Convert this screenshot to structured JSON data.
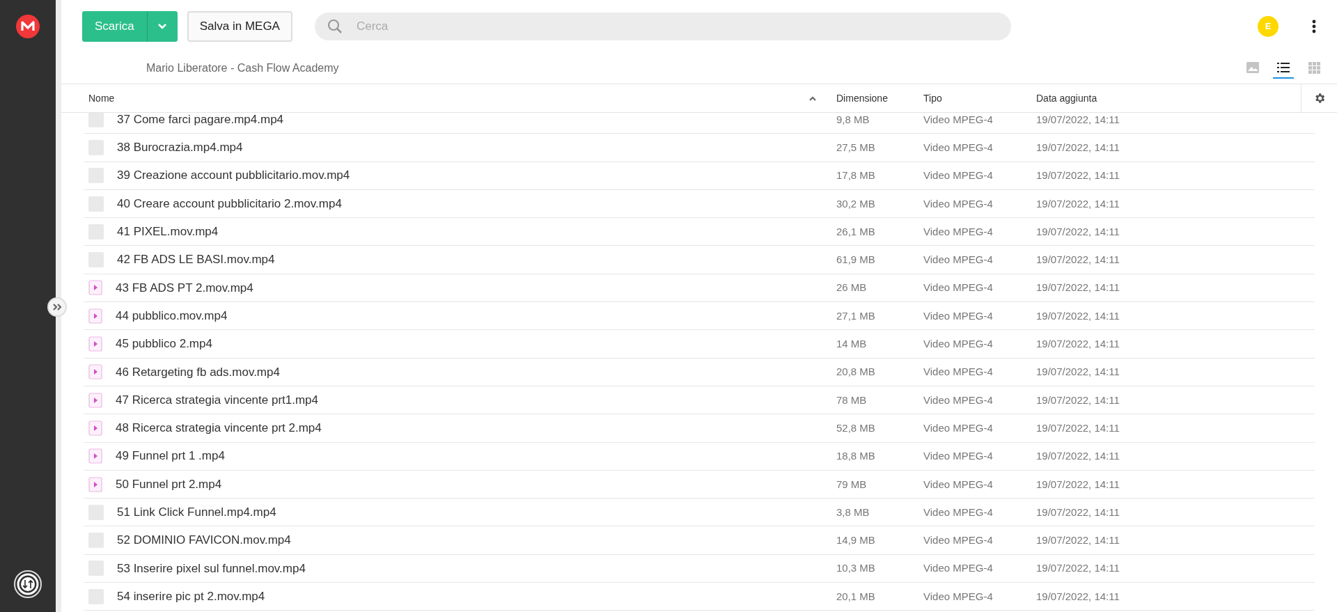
{
  "toolbar": {
    "download_button": {
      "label": "Scarica"
    },
    "save_button": {
      "label": "Salva in MEGA"
    },
    "search": {
      "placeholder": "Cerca"
    },
    "avatar": {
      "initial": "E"
    }
  },
  "breadcrumb": "Mario Liberatore - Cash Flow Academy",
  "view_modes": [
    {
      "kind": "thumbnails",
      "selected": false
    },
    {
      "kind": "list",
      "selected": true
    },
    {
      "kind": "grid",
      "selected": false
    }
  ],
  "table": {
    "columns": [
      {
        "label": "Nome",
        "sorted": true
      },
      {
        "label": "Dimensione",
        "sorted": false
      },
      {
        "label": "Tipo",
        "sorted": false
      },
      {
        "label": "Data aggiunta",
        "sorted": false
      }
    ],
    "rows": [
      {
        "kind": "thumbnail",
        "name": "37 Come farci pagare.mp4.mp4",
        "size": "9,8 MB",
        "type": "Video MPEG-4",
        "added": "19/07/2022, 14:11"
      },
      {
        "kind": "thumbnail",
        "name": "38 Burocrazia.mp4.mp4",
        "size": "27,5 MB",
        "type": "Video MPEG-4",
        "added": "19/07/2022, 14:11"
      },
      {
        "kind": "thumbnail",
        "name": "39 Creazione account pubblicitario.mov.mp4",
        "size": "17,8 MB",
        "type": "Video MPEG-4",
        "added": "19/07/2022, 14:11"
      },
      {
        "kind": "thumbnail",
        "name": "40 Creare account pubblicitario 2.mov.mp4",
        "size": "30,2 MB",
        "type": "Video MPEG-4",
        "added": "19/07/2022, 14:11"
      },
      {
        "kind": "thumbnail",
        "name": "41 PIXEL.mov.mp4",
        "size": "26,1 MB",
        "type": "Video MPEG-4",
        "added": "19/07/2022, 14:11"
      },
      {
        "kind": "thumbnail",
        "name": "42 FB ADS LE BASI.mov.mp4",
        "size": "61,9 MB",
        "type": "Video MPEG-4",
        "added": "19/07/2022, 14:11"
      },
      {
        "kind": "video",
        "name": "43 FB ADS PT 2.mov.mp4",
        "size": "26 MB",
        "type": "Video MPEG-4",
        "added": "19/07/2022, 14:11"
      },
      {
        "kind": "video",
        "name": "44 pubblico.mov.mp4",
        "size": "27,1 MB",
        "type": "Video MPEG-4",
        "added": "19/07/2022, 14:11"
      },
      {
        "kind": "video",
        "name": "45 pubblico 2.mp4",
        "size": "14 MB",
        "type": "Video MPEG-4",
        "added": "19/07/2022, 14:11"
      },
      {
        "kind": "video",
        "name": "46 Retargeting fb ads.mov.mp4",
        "size": "20,8 MB",
        "type": "Video MPEG-4",
        "added": "19/07/2022, 14:11"
      },
      {
        "kind": "video",
        "name": "47 Ricerca strategia vincente prt1.mp4",
        "size": "78 MB",
        "type": "Video MPEG-4",
        "added": "19/07/2022, 14:11"
      },
      {
        "kind": "video",
        "name": "48 Ricerca strategia vincente prt 2.mp4",
        "size": "52,8 MB",
        "type": "Video MPEG-4",
        "added": "19/07/2022, 14:11"
      },
      {
        "kind": "video",
        "name": "49 Funnel prt 1 .mp4",
        "size": "18,8 MB",
        "type": "Video MPEG-4",
        "added": "19/07/2022, 14:11"
      },
      {
        "kind": "video",
        "name": "50 Funnel prt 2.mp4",
        "size": "79 MB",
        "type": "Video MPEG-4",
        "added": "19/07/2022, 14:11"
      },
      {
        "kind": "thumbnail",
        "name": "51 Link Click Funnel.mp4.mp4",
        "size": "3,8 MB",
        "type": "Video MPEG-4",
        "added": "19/07/2022, 14:11"
      },
      {
        "kind": "thumbnail",
        "name": "52 DOMINIO FAVICON.mov.mp4",
        "size": "14,9 MB",
        "type": "Video MPEG-4",
        "added": "19/07/2022, 14:11"
      },
      {
        "kind": "thumbnail",
        "name": "53 Inserire pixel sul funnel.mov.mp4",
        "size": "10,3 MB",
        "type": "Video MPEG-4",
        "added": "19/07/2022, 14:11"
      },
      {
        "kind": "thumbnail",
        "name": "54 inserire pic pt 2.mov.mp4",
        "size": "20,1 MB",
        "type": "Video MPEG-4",
        "added": "19/07/2022, 14:11"
      }
    ]
  }
}
